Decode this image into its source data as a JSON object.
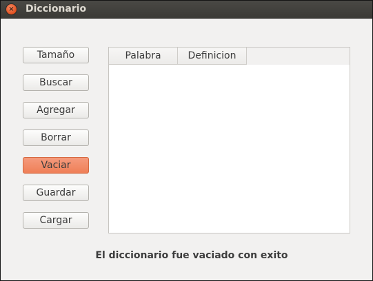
{
  "window": {
    "title": "Diccionario",
    "close_glyph": "×"
  },
  "buttons": [
    {
      "label": "Tamaño"
    },
    {
      "label": "Buscar"
    },
    {
      "label": "Agregar"
    },
    {
      "label": "Borrar"
    },
    {
      "label": "Vaciar",
      "active": true
    },
    {
      "label": "Guardar"
    },
    {
      "label": "Cargar"
    }
  ],
  "table": {
    "columns": [
      "Palabra",
      "Definicion"
    ],
    "rows": []
  },
  "status": {
    "message": "El diccionario fue vaciado con exito"
  },
  "colors": {
    "titlebar": "#3c3b37",
    "close_button": "#e8592c",
    "active_button": "#f08a64",
    "window_bg": "#f2f1f0"
  }
}
